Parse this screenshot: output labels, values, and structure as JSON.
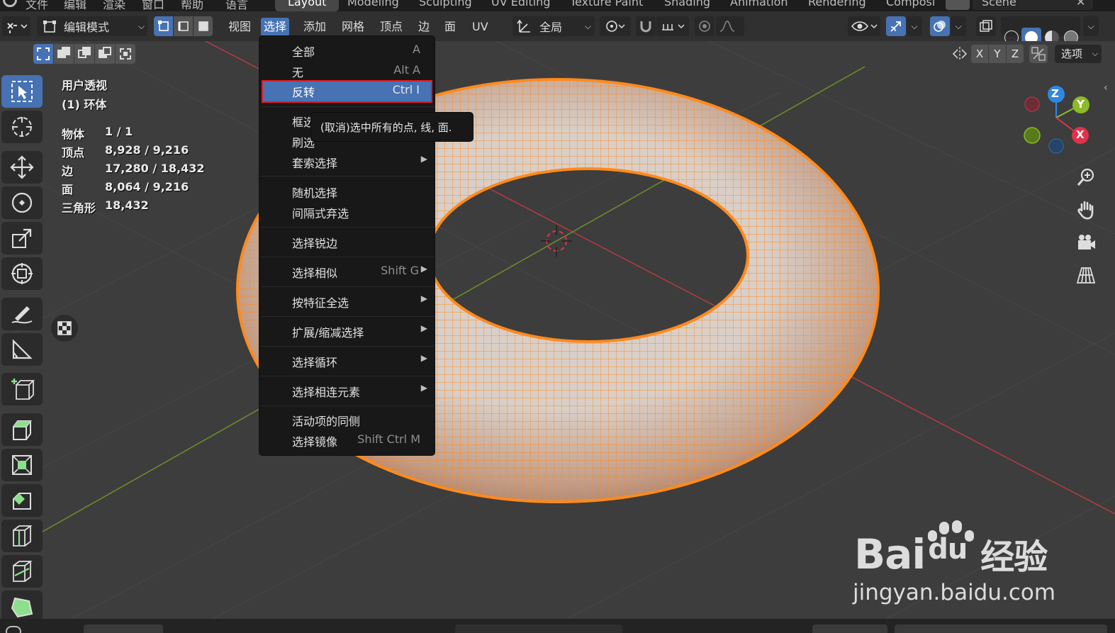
{
  "app": "Blender",
  "workspace_tabs": [
    "Layout",
    "Modeling",
    "Sculpting",
    "UV Editing",
    "Texture Paint",
    "Shading",
    "Animation",
    "Rendering",
    "Composi"
  ],
  "top_menu": [
    "文件",
    "编辑",
    "渲染",
    "窗口",
    "帮助",
    "语言"
  ],
  "scene_name": "Scene",
  "header": {
    "mode_label": "编辑模式",
    "menus": [
      "视图",
      "选择",
      "添加",
      "网格",
      "顶点",
      "边",
      "面",
      "UV"
    ],
    "transform_orientation": "全局",
    "options_label": "选项",
    "axis_labels": [
      "X",
      "Y",
      "Z"
    ]
  },
  "viewport": {
    "view_name": "用户透视",
    "object_name": "(1) 环体",
    "stats": [
      {
        "label": "物体",
        "value": "1 / 1"
      },
      {
        "label": "顶点",
        "value": "8,928 / 9,216"
      },
      {
        "label": "边",
        "value": "17,280 / 18,432"
      },
      {
        "label": "面",
        "value": "8,064 / 9,216"
      },
      {
        "label": "三角形",
        "value": "18,432"
      }
    ]
  },
  "select_menu": {
    "items": [
      {
        "label": "全部",
        "shortcut": "A"
      },
      {
        "label": "无",
        "shortcut": "Alt A"
      },
      {
        "label": "反转",
        "shortcut": "Ctrl I",
        "highlighted": true
      },
      {
        "label": "框选"
      },
      {
        "label": "刷选"
      },
      {
        "label": "套索选择",
        "submenu": true
      },
      {
        "label": "随机选择"
      },
      {
        "label": "间隔式弃选"
      },
      {
        "label": "选择锐边"
      },
      {
        "label": "选择相似",
        "shortcut": "Shift G",
        "submenu": true
      },
      {
        "label": "按特征全选",
        "submenu": true
      },
      {
        "label": "扩展/缩减选择",
        "submenu": true
      },
      {
        "label": "选择循环",
        "submenu": true
      },
      {
        "label": "选择相连元素",
        "submenu": true
      },
      {
        "label": "活动项的同侧"
      },
      {
        "label": "选择镜像",
        "shortcut": "Shift Ctrl M"
      }
    ],
    "tooltip": "(取消)选中所有的点, 线, 面."
  },
  "gizmo": {
    "x": "X",
    "y": "Y",
    "z": "Z"
  },
  "watermark": {
    "line1": "Bai",
    "line1_b": "du",
    "line1_c": "经验",
    "line2": "jingyan.baidu.com"
  },
  "colors": {
    "accent": "#4772b3",
    "highlight_border": "#e01b24",
    "selection_orange": "#ff8a1c",
    "axis_x": "#e0324b",
    "axis_y": "#8bbb27",
    "axis_z": "#2f87e0"
  },
  "icons": [
    "blender-logo",
    "select-box-icon",
    "cursor-icon",
    "move-icon",
    "rotate-icon",
    "scale-icon",
    "transform-icon",
    "annotate-icon",
    "measure-icon",
    "add-cube-icon",
    "extrude-icon",
    "inset-icon",
    "bevel-icon",
    "loop-cut-icon",
    "knife-icon",
    "shrink-icon",
    "zoom-icon",
    "hand-icon",
    "camera-icon",
    "grid-icon",
    "checker-icon"
  ]
}
